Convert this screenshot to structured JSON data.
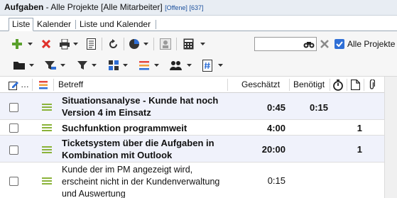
{
  "window": {
    "title": "Aufgaben",
    "subtitle": " - Alle Projekte [Alle Mitarbeiter] ",
    "filter": "[Offene]",
    "count": " [637]"
  },
  "tabs": [
    {
      "label": "Liste",
      "active": true
    },
    {
      "label": "Kalender",
      "active": false
    },
    {
      "label": "Liste und Kalender",
      "active": false
    }
  ],
  "toolbar": {
    "search_value": "",
    "all_projects_checked": true,
    "all_projects_label": "Alle Projekte",
    "icons": [
      "add-icon",
      "delete-icon",
      "print-icon",
      "document-icon",
      "refresh-icon",
      "pie-chart-icon",
      "report-icon",
      "calculator-icon",
      "binoculars-icon",
      "close-icon"
    ],
    "icons_row2": [
      "folder-icon",
      "filter-edit-icon",
      "filter-icon",
      "layout-icon",
      "list-lines-icon",
      "people-icon",
      "hash-document-icon"
    ]
  },
  "grid": {
    "columns": {
      "edit": "…",
      "subject": "Betreff",
      "estimated": "Geschätzt",
      "needed": "Benötigt"
    },
    "rows": [
      {
        "subject": "Situationsanalyse - Kunde hat noch Version 4 im Einsatz",
        "estimated": "0:45",
        "needed": "0:15",
        "count": "",
        "bold": true
      },
      {
        "subject": "Suchfunktion programmweit",
        "estimated": "4:00",
        "needed": "",
        "count": "1",
        "bold": true
      },
      {
        "subject": "Ticketsystem über die Aufgaben in Kombination mit Outlook",
        "estimated": "20:00",
        "needed": "",
        "count": "1",
        "bold": true
      },
      {
        "subject": "Kunde der im PM angezeigt wird, erscheint nicht in der Kundenverwaltung und Auswertung",
        "estimated": "0:15",
        "needed": "",
        "count": "",
        "bold": false
      }
    ]
  },
  "colors": {
    "accent": "#2f6fd6",
    "priority": "#8bb33a",
    "link": "#1a4f9c",
    "row_alt": "#f0f2fb"
  }
}
